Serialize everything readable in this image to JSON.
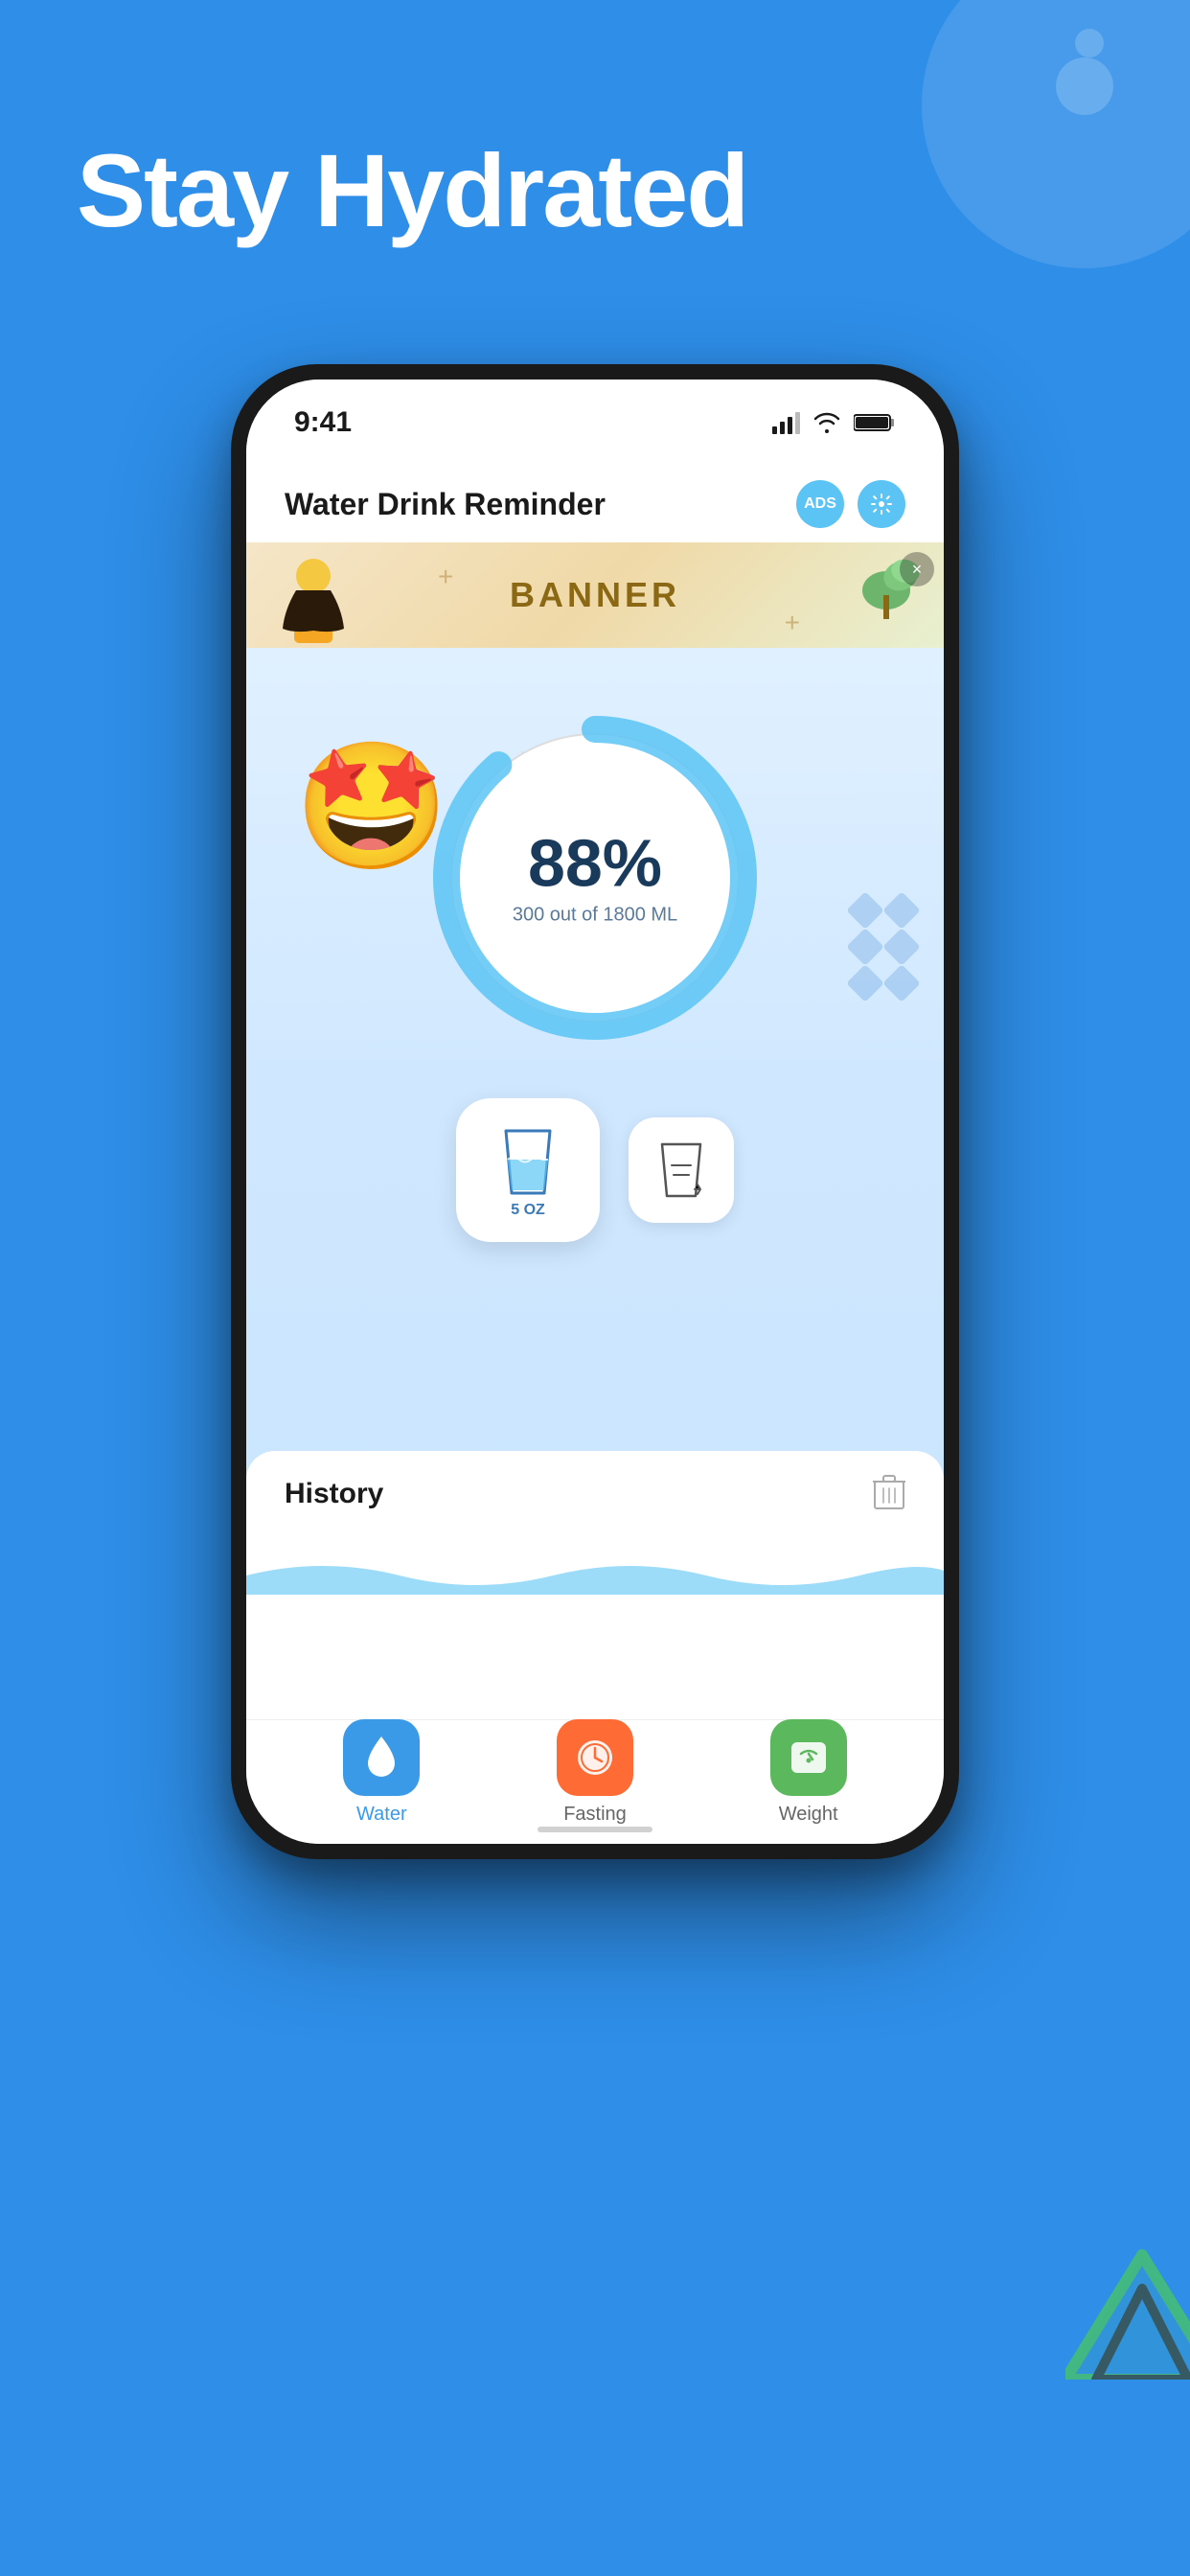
{
  "page": {
    "title": "Stay Hydrated",
    "background_color": "#2E8EE8"
  },
  "status_bar": {
    "time": "9:41"
  },
  "app_header": {
    "title": "Water Drink Reminder",
    "ads_label": "ADS"
  },
  "banner": {
    "text": "BANNER",
    "close_label": "×"
  },
  "progress": {
    "percent": "88%",
    "description": "300 out of 1800 ML",
    "current": 300,
    "total": 1800,
    "unit": "ML",
    "fill_ratio": 0.88
  },
  "cups": {
    "primary_label": "5\nOZ",
    "secondary_icon": "custom-cup"
  },
  "history": {
    "title": "History"
  },
  "bottom_nav": {
    "items": [
      {
        "id": "water",
        "label": "Water",
        "active": true
      },
      {
        "id": "fasting",
        "label": "Fasting",
        "active": false
      },
      {
        "id": "weight",
        "label": "Weight",
        "active": false
      }
    ]
  },
  "decorations": {
    "diamonds": 6
  }
}
